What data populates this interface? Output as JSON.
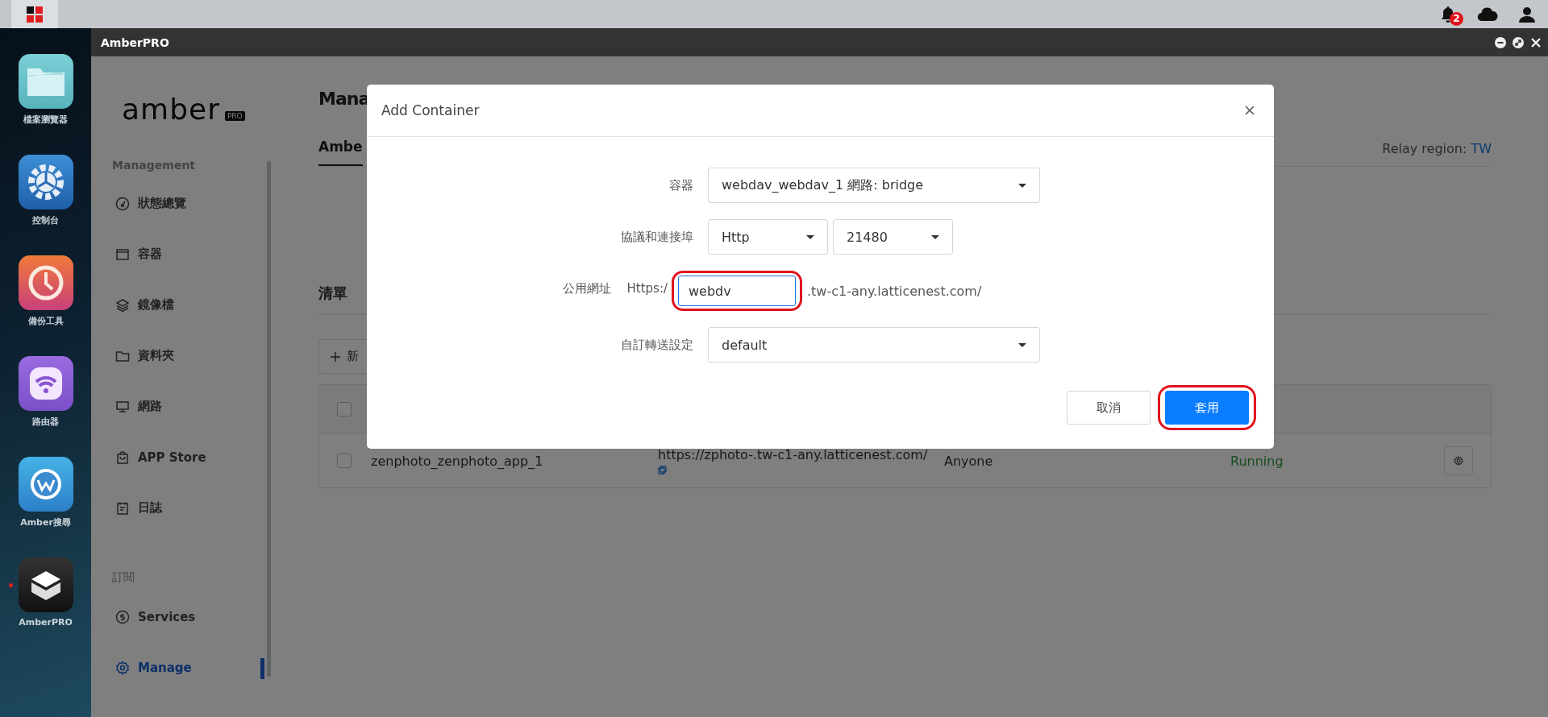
{
  "taskbar": {
    "notification_count": "2"
  },
  "dock": [
    {
      "label": "檔案瀏覽器",
      "running": false
    },
    {
      "label": "控制台",
      "running": false
    },
    {
      "label": "備份工具",
      "running": false
    },
    {
      "label": "路由器",
      "running": false
    },
    {
      "label": "Amber搜尋",
      "running": false
    },
    {
      "label": "AmberPRO",
      "running": true
    }
  ],
  "window": {
    "title": "AmberPRO"
  },
  "sidebar": {
    "logo": "amber",
    "logo_badge": "PRO",
    "sections": [
      {
        "heading": "Management",
        "items": [
          {
            "label": "狀態總覽",
            "selected": false
          },
          {
            "label": "容器",
            "selected": false
          },
          {
            "label": "鏡像檔",
            "selected": false
          },
          {
            "label": "資料夾",
            "selected": false
          },
          {
            "label": "網路",
            "selected": false
          },
          {
            "label": "APP Store",
            "selected": false
          },
          {
            "label": "日誌",
            "selected": false
          }
        ]
      },
      {
        "heading": "訂閱",
        "items": [
          {
            "label": "Services",
            "selected": false
          },
          {
            "label": "Manage",
            "selected": true
          }
        ]
      }
    ]
  },
  "main": {
    "title": "Mana",
    "tab": {
      "label": "Ambe",
      "selected": true
    },
    "relay_label": "Relay region:",
    "relay_value": "TW",
    "list_title": "清單",
    "add_button": "新",
    "table": {
      "header_checked": false,
      "rows": [
        {
          "name": "zenphoto_zenphoto_app_1",
          "url": "https://zphoto-.tw-c1-any.latticenest.com/",
          "access": "Anyone",
          "status": "Running",
          "checked": false
        }
      ]
    }
  },
  "dialog": {
    "title": "Add Container",
    "fields": [
      {
        "kind": "select",
        "label": "容器",
        "value": "webdav_webdav_1 網路: bridge"
      },
      {
        "kind": "select_pair",
        "label": "協議和連接埠",
        "values": [
          "Http",
          "21480"
        ]
      },
      {
        "kind": "url",
        "label": "公用網址",
        "prefix": "Https:/",
        "value": "webdv",
        "suffix": ".tw-c1-any.latticenest.com/",
        "highlighted": true
      },
      {
        "kind": "select",
        "label": "自訂轉送設定",
        "value": "default"
      }
    ],
    "buttons": [
      {
        "label": "取消",
        "primary": false,
        "highlighted": false
      },
      {
        "label": "套用",
        "primary": true,
        "highlighted": true
      }
    ]
  }
}
